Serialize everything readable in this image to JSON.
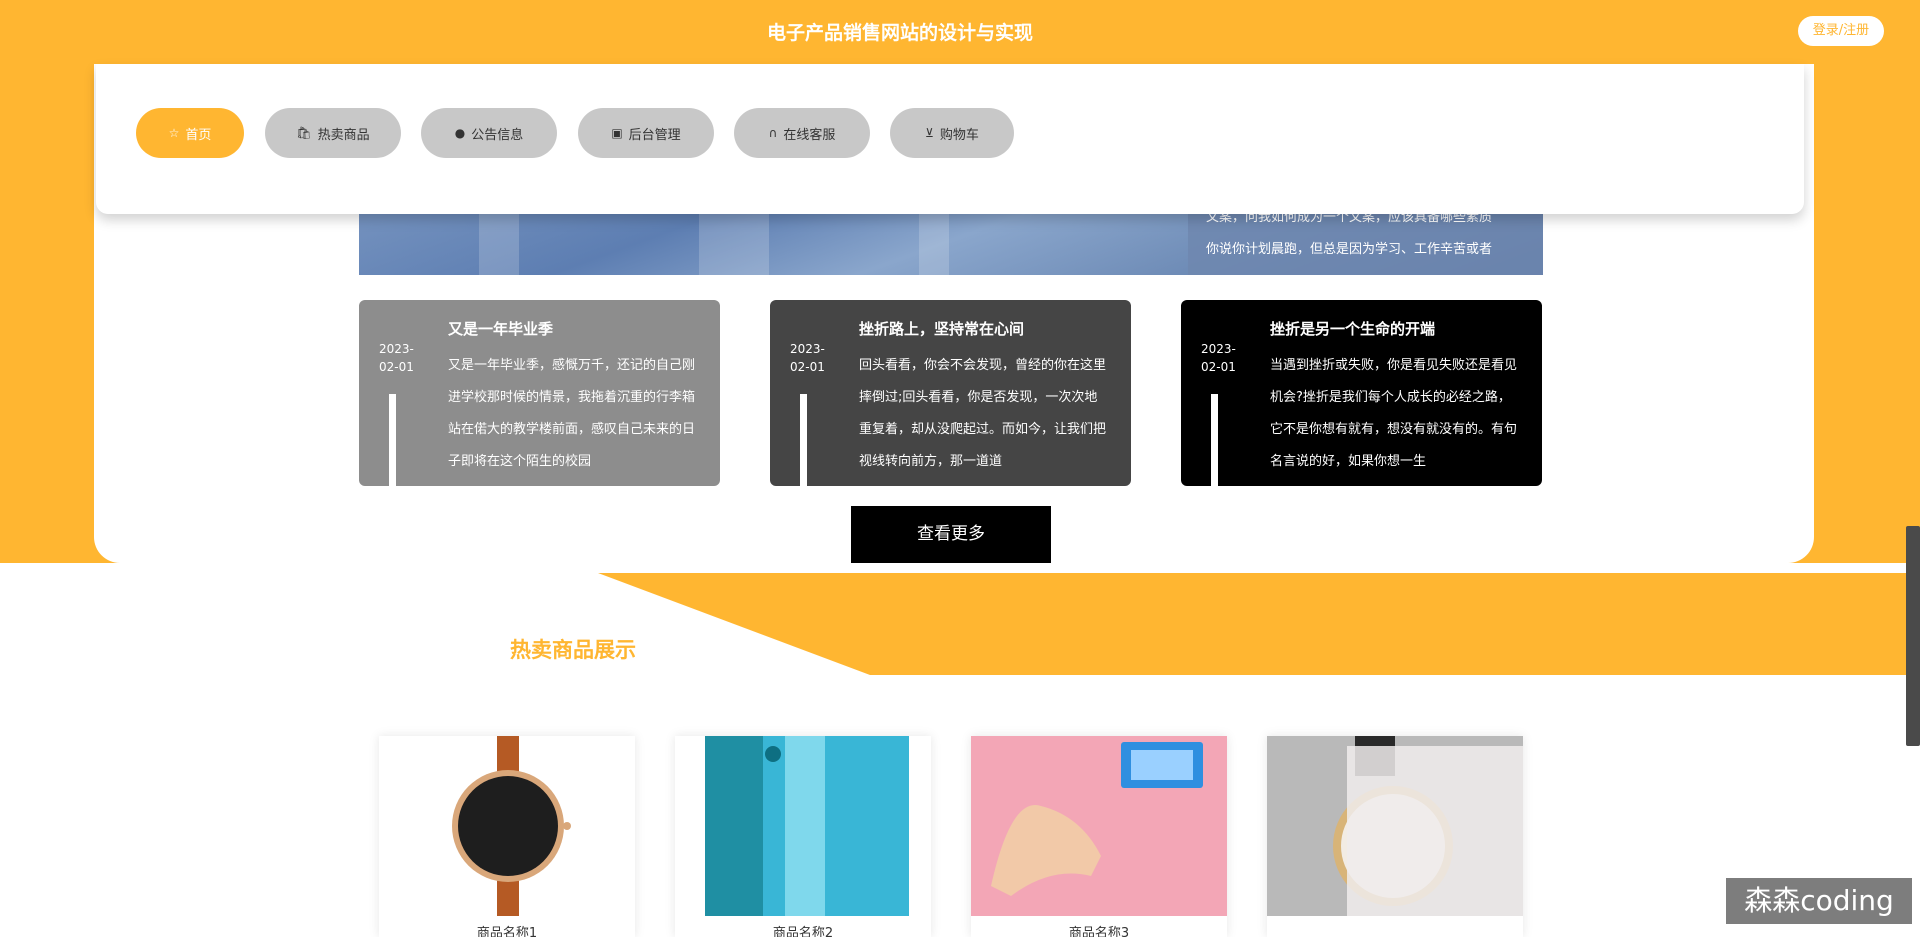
{
  "header": {
    "site_title": "电子产品销售网站的设计与实现",
    "login_label": "登录/注册"
  },
  "nav": {
    "items": [
      {
        "label": "首页",
        "icon": "star-icon"
      },
      {
        "label": "热卖商品",
        "icon": "bag-icon"
      },
      {
        "label": "公告信息",
        "icon": "info-icon"
      },
      {
        "label": "后台管理",
        "icon": "briefcase-icon"
      },
      {
        "label": "在线客服",
        "icon": "headset-icon"
      },
      {
        "label": "购物车",
        "icon": "cart-icon"
      }
    ]
  },
  "hero": {
    "lines": [
      "文案，问我如何成为一个文案，应该具备哪些素质",
      "你说你计划晨跑，但总是因为学习、工作辛苦或者"
    ]
  },
  "news": [
    {
      "date": "2023-02-01",
      "title": "又是一年毕业季",
      "excerpt": "又是一年毕业季，感慨万千，还记的自己刚进学校那时候的情景，我拖着沉重的行李箱站在偌大的教学楼前面，感叹自己未来的日子即将在这个陌生的校园",
      "bg": "#8d8d8d"
    },
    {
      "date": "2023-02-01",
      "title": "挫折路上，坚持常在心间",
      "excerpt": "回头看看，你会不会发现，曾经的你在这里摔倒过;回头看看，你是否发现，一次次地重复着，却从没爬起过。而如今，让我们把视线转向前方，那一道道",
      "bg": "#454545"
    },
    {
      "date": "2023-02-01",
      "title": "挫折是另一个生命的开端",
      "excerpt": "当遇到挫折或失败，你是看见失败还是看见机会?挫折是我们每个人成长的必经之路，它不是你想有就有，想没有就没有的。有句名言说的好，如果你想一生",
      "bg": "#000000"
    }
  ],
  "more_label": "查看更多",
  "products_section": {
    "title": "热卖商品展示",
    "items": [
      {
        "name": "商品名称1"
      },
      {
        "name": "商品名称2"
      },
      {
        "name": "商品名称3"
      },
      {
        "name": ""
      }
    ]
  },
  "watermark": "森森coding",
  "colors": {
    "accent": "#ffb631",
    "button_dark": "#000000",
    "nav_inactive": "#c8c8c8"
  }
}
